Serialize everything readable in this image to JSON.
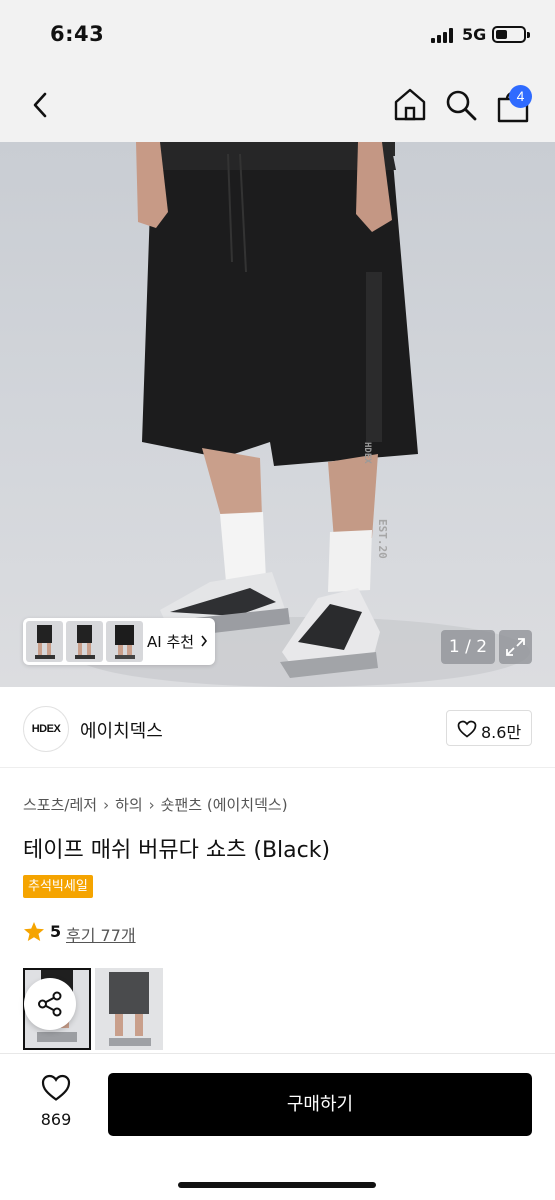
{
  "status_bar": {
    "time": "6:43",
    "network": "5G"
  },
  "nav": {
    "cart_count": "4"
  },
  "gallery": {
    "ai_recommend_label": "AI 추천",
    "page_indicator": "1 / 2",
    "print_text_1": "HDEX",
    "print_text_2": "EST.20"
  },
  "brand": {
    "logo_text": "HDEX",
    "name": "에이치덱스",
    "likes": "8.6만"
  },
  "product": {
    "breadcrumb": [
      "스포츠/레저",
      "하의",
      "숏팬츠 (에이치덱스)"
    ],
    "title": "테이프 매쉬 버뮤다 쇼츠 (Black)",
    "sale_badge": "추석빅세일",
    "rating": "5",
    "review_label": "후기 77개"
  },
  "bottom_bar": {
    "like_count": "869",
    "buy_label": "구매하기"
  },
  "colors": {
    "accent_badge": "#f5a400",
    "cart_badge": "#2f6bff",
    "buy_button": "#000000",
    "star": "#f5a400"
  },
  "icons": [
    "back-icon",
    "home-icon",
    "search-icon",
    "cart-icon",
    "expand-icon",
    "heart-icon",
    "star-icon",
    "share-icon",
    "chevron-right-icon"
  ]
}
